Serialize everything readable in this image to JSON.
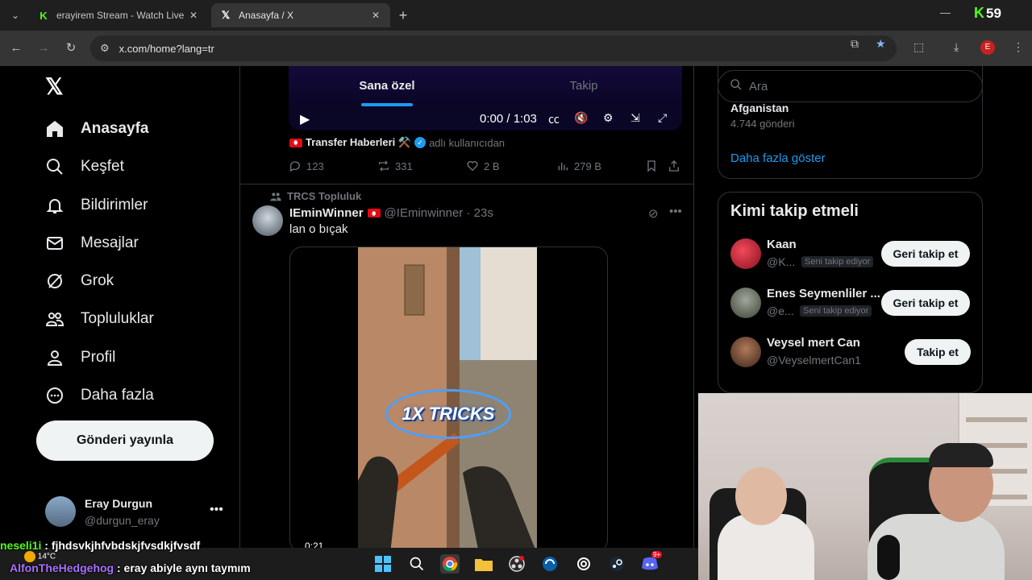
{
  "browser": {
    "tabs": [
      {
        "title": "erayirem Stream - Watch Live o",
        "favicon": "kick-icon"
      },
      {
        "title": "Anasayfa / X",
        "favicon": "x-icon"
      }
    ],
    "url": "x.com/home?lang=tr",
    "kick_count": "59",
    "profile_initial": "E"
  },
  "nav": {
    "items": [
      {
        "label": "Anasayfa",
        "icon": "home-icon",
        "active": true
      },
      {
        "label": "Keşfet",
        "icon": "search-icon"
      },
      {
        "label": "Bildirimler",
        "icon": "bell-icon"
      },
      {
        "label": "Mesajlar",
        "icon": "mail-icon"
      },
      {
        "label": "Grok",
        "icon": "grok-icon"
      },
      {
        "label": "Topluluklar",
        "icon": "communities-icon"
      },
      {
        "label": "Profil",
        "icon": "profile-icon"
      },
      {
        "label": "Daha fazla",
        "icon": "more-circle-icon"
      }
    ],
    "post_button": "Gönderi yayınla",
    "account": {
      "name": "Eray Durgun",
      "handle": "@durgun_eray"
    }
  },
  "feed": {
    "tabs": [
      "Sana özel",
      "Takip"
    ],
    "player_time": "0:00 / 1:03",
    "credit": {
      "source": "Transfer Haberleri ⚒️",
      "suffix": "adlı kullanıcıdan"
    },
    "stats": {
      "replies": "123",
      "reposts": "331",
      "likes": "2 B",
      "views": "279 B"
    },
    "tweet": {
      "community": "TRCS Topluluk",
      "name": "IEminWinner",
      "handle": "@IEminwinner · 23s",
      "text": "lan o bıçak",
      "video_time": "0:21",
      "overlay_text": "1X TRICKS"
    }
  },
  "right": {
    "search_placeholder": "Ara",
    "trend": {
      "name": "Afganistan",
      "count": "4.744 gönderi",
      "more": "Daha fazla göster"
    },
    "who_to_follow": {
      "title": "Kimi takip etmeli",
      "people": [
        {
          "name": "Kaan",
          "handle": "@K...",
          "follows_you": "Seni takip ediyor",
          "button": "Geri takip et"
        },
        {
          "name": "Enes Seymenliler ...",
          "handle": "@e...",
          "follows_you": "Seni takip ediyor",
          "button": "Geri takip et"
        },
        {
          "name": "Veysel mert Can",
          "handle": "@VeyselmertCan1",
          "follows_you": "",
          "button": "Takip et"
        }
      ]
    }
  },
  "chat": [
    {
      "user": "neseli1i",
      "message": ": fjhdsvkjhfvbdskjfvsdkjfvsdf"
    },
    {
      "user": "AlfonTheHedgehog",
      "message": ": eray abiyle aynı taymım"
    }
  ],
  "taskbar": {
    "weather": "14°C",
    "notif_badge": "9+"
  }
}
